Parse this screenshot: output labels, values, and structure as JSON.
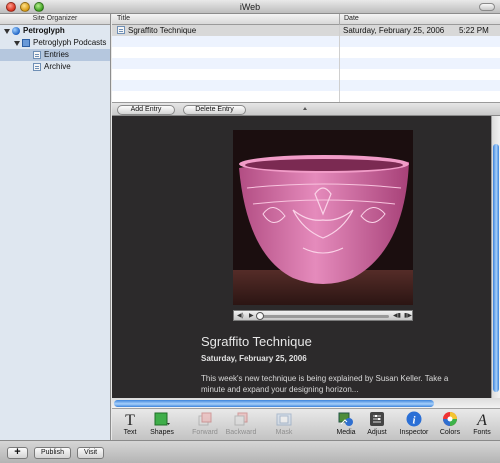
{
  "window": {
    "title": "iWeb"
  },
  "sidebar": {
    "header": "Site Organizer",
    "items": [
      {
        "label": "Petroglyph",
        "level": 0,
        "icon": "globe-icon",
        "bold": true
      },
      {
        "label": "Petroglyph Podcasts",
        "level": 1,
        "icon": "podcast-page-icon"
      },
      {
        "label": "Entries",
        "level": 2,
        "icon": "entries-page-icon",
        "selected": true
      },
      {
        "label": "Archive",
        "level": 2,
        "icon": "archive-page-icon"
      }
    ]
  },
  "entries_table": {
    "columns": [
      "Title",
      "Date"
    ],
    "rows": [
      {
        "title": "Sgraffito Technique",
        "date": "Saturday, February 25, 2006",
        "time": "5:22 PM"
      }
    ]
  },
  "entry_toolbar": {
    "add_label": "Add Entry",
    "delete_label": "Delete Entry"
  },
  "post": {
    "title": "Sgraffito Technique",
    "date": "Saturday, February 25, 2006",
    "body": "This week's new technique is being explained by Susan Keller. Take a minute and expand your designing horizon..."
  },
  "toolbar": [
    {
      "label": "Text",
      "icon": "text-icon",
      "enabled": true
    },
    {
      "label": "Shapes",
      "icon": "shapes-icon",
      "enabled": true
    },
    {
      "label": "Forward",
      "icon": "bring-forward-icon",
      "enabled": false
    },
    {
      "label": "Backward",
      "icon": "send-backward-icon",
      "enabled": false
    },
    {
      "label": "Mask",
      "icon": "mask-icon",
      "enabled": false
    },
    {
      "label": "Media",
      "icon": "media-icon",
      "enabled": true
    },
    {
      "label": "Adjust",
      "icon": "adjust-icon",
      "enabled": true
    },
    {
      "label": "Inspector",
      "icon": "inspector-icon",
      "enabled": true
    },
    {
      "label": "Colors",
      "icon": "colors-icon",
      "enabled": true
    },
    {
      "label": "Fonts",
      "icon": "fonts-icon",
      "enabled": true
    }
  ],
  "bottom_bar": {
    "add_label": "+",
    "publish_label": "Publish",
    "visit_label": "Visit"
  },
  "colors": {
    "selection": "#b5c7de",
    "accent": "#3c83da",
    "page_background": "#2c2a2b"
  }
}
